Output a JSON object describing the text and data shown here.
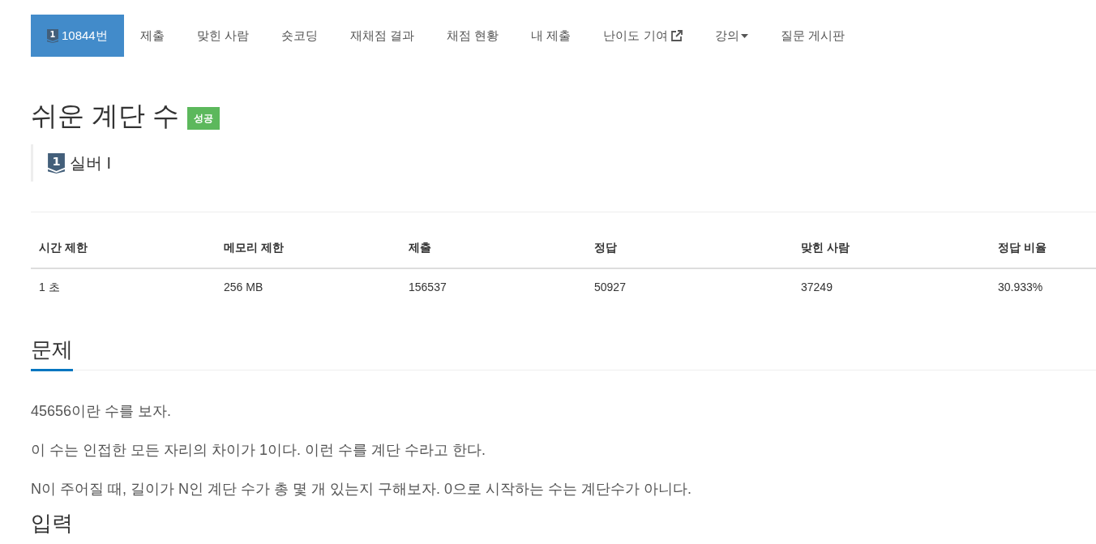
{
  "nav": {
    "items": [
      {
        "kind": "problem",
        "label": "10844번",
        "icon_digit": "1",
        "selected": true
      },
      {
        "kind": "link",
        "label": "제출",
        "selected": false
      },
      {
        "kind": "link",
        "label": "맞힌 사람",
        "selected": false
      },
      {
        "kind": "link",
        "label": "숏코딩",
        "selected": false
      },
      {
        "kind": "link",
        "label": "재채점 결과",
        "selected": false
      },
      {
        "kind": "link",
        "label": "채점 현황",
        "selected": false
      },
      {
        "kind": "link",
        "label": "내 제출",
        "selected": false
      },
      {
        "kind": "external",
        "label": "난이도 기여",
        "selected": false
      },
      {
        "kind": "dropdown",
        "label": "강의",
        "selected": false
      },
      {
        "kind": "link",
        "label": "질문 게시판",
        "selected": false
      }
    ]
  },
  "title": "쉬운 계단 수",
  "result_badge": "성공",
  "tier": {
    "icon_digit": "1",
    "label": "실버 I"
  },
  "stats": {
    "columns": [
      "시간 제한",
      "메모리 제한",
      "제출",
      "정답",
      "맞힌 사람",
      "정답 비율"
    ],
    "rows": [
      [
        "1 초",
        "256 MB",
        "156537",
        "50927",
        "37249",
        "30.933%"
      ]
    ]
  },
  "problem_section": {
    "heading": "문제",
    "paragraphs": [
      "45656이란 수를 보자.",
      "이 수는 인접한 모든 자리의 차이가 1이다. 이런 수를 계단 수라고 한다.",
      "N이 주어질 때, 길이가 N인 계단 수가 총 몇 개 있는지 구해보자. 0으로 시작하는 수는 계단수가 아니다."
    ]
  },
  "next_section": {
    "heading": "입력"
  }
}
